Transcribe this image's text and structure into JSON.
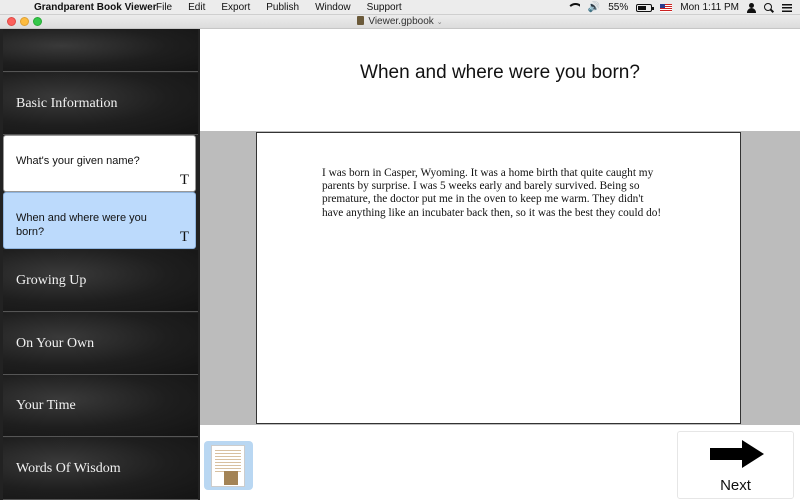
{
  "menubar": {
    "app_name": "Grandparent Book Viewer",
    "menus": [
      "File",
      "Edit",
      "Export",
      "Publish",
      "Window",
      "Support"
    ],
    "battery_percent": "55%",
    "battery_level": 0.55,
    "clock": "Mon 1:11 PM",
    "icons": [
      "apple-icon",
      "wifi-icon",
      "volume-icon",
      "battery-icon",
      "us-flag-icon",
      "user-icon",
      "search-icon",
      "list-icon"
    ]
  },
  "window": {
    "title": "Viewer.gpbook"
  },
  "sidebar": {
    "sections": [
      {
        "label": ""
      },
      {
        "label": "Basic Information"
      },
      {
        "label": "Growing Up"
      },
      {
        "label": "On Your Own"
      },
      {
        "label": "Your Time"
      },
      {
        "label": "Words Of Wisdom"
      }
    ],
    "questions": [
      {
        "label": "What's your given name?",
        "type_glyph": "T",
        "selected": false
      },
      {
        "label": "When and where were you born?",
        "type_glyph": "T",
        "selected": true
      }
    ]
  },
  "main": {
    "question_title": "When and where were you born?",
    "answer_text": "I was born in Casper, Wyoming. It was a home birth that quite caught my parents by surprise. I was 5 weeks early and barely survived. Being so premature, the doctor put me in the oven to keep me warm. They didn't have anything like an incubater back then, so it was the best they could do!"
  },
  "footer": {
    "next_label": "Next"
  },
  "colors": {
    "selected_question": "#bcdafc",
    "canvas_band": "#bcbcbc",
    "sidebar_dark": "#1e1e1e"
  }
}
